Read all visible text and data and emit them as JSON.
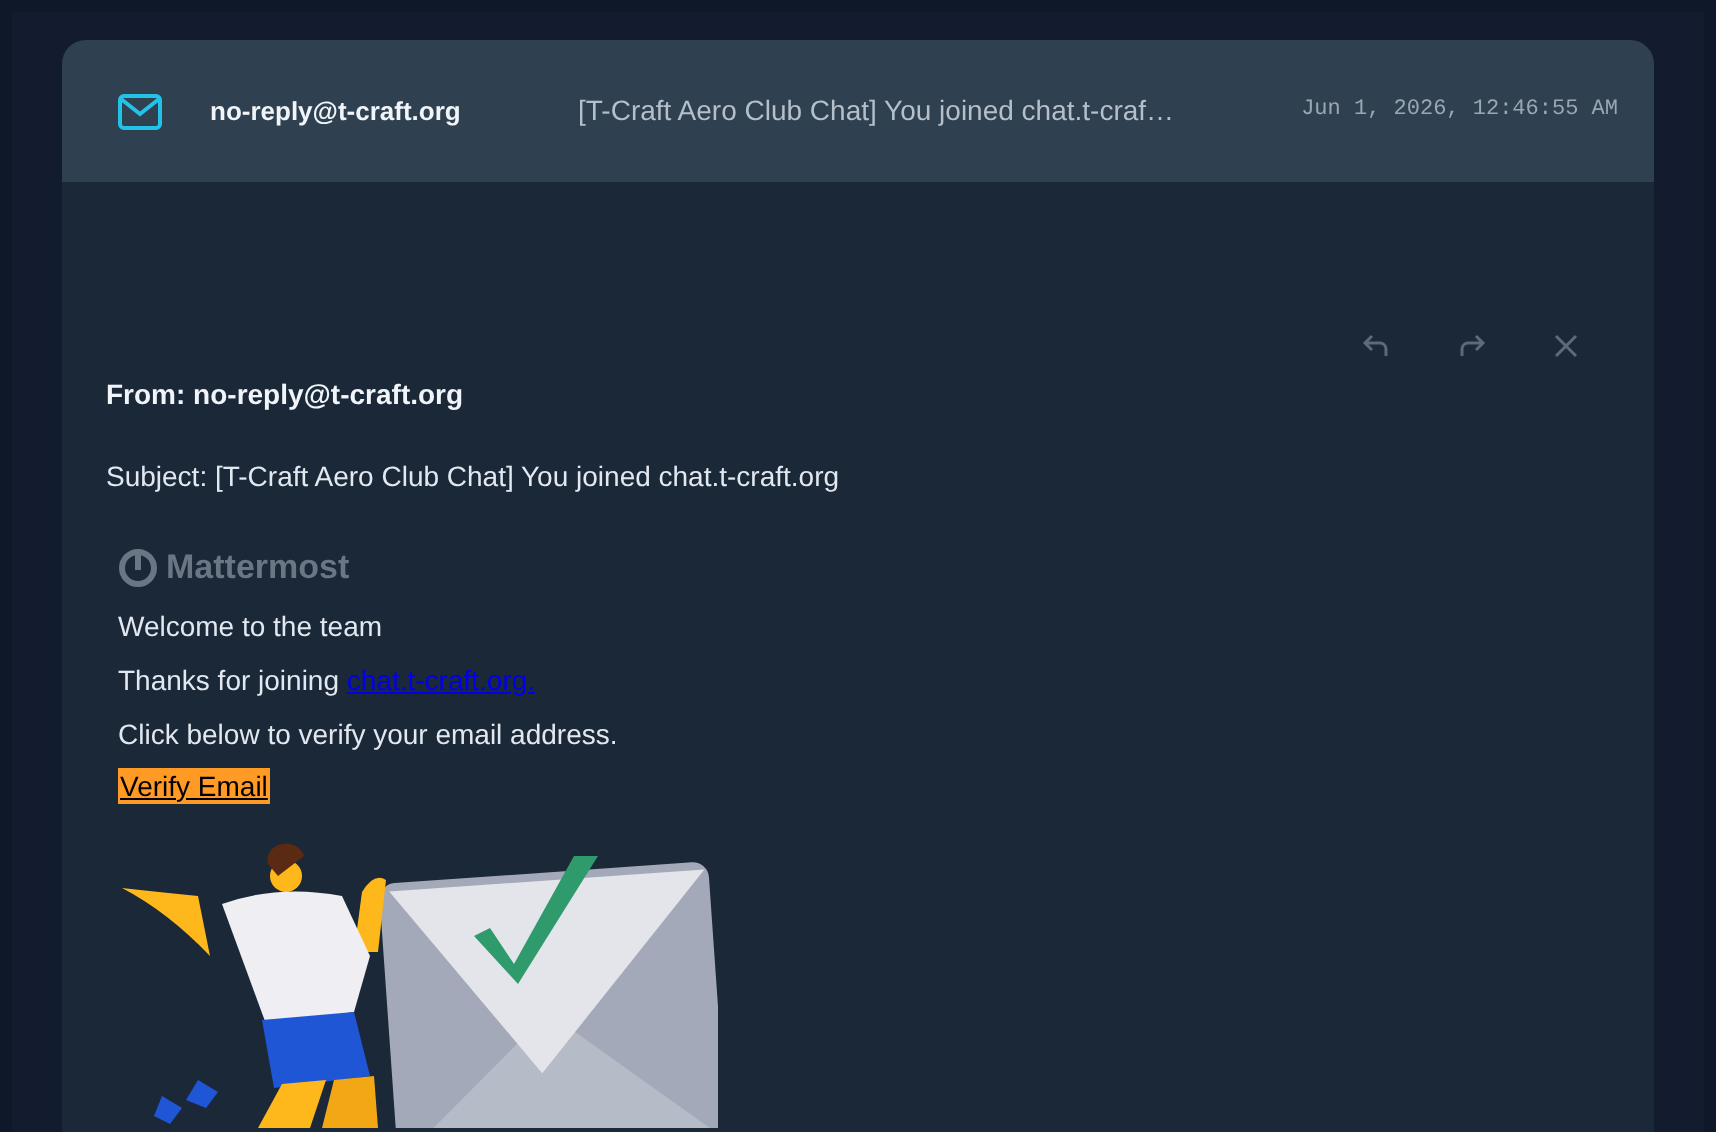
{
  "header": {
    "sender": "no-reply@t-craft.org",
    "subject": "[T-Craft Aero Club Chat] You joined chat.t-craf…",
    "date": "Jun 1, 2026, 12:46:55 AM"
  },
  "message": {
    "from": "From: no-reply@t-craft.org",
    "subject": "Subject: [T-Craft Aero Club Chat] You joined chat.t-craft.org"
  },
  "email_body": {
    "logo_text": "Mattermost",
    "welcome": "Welcome to the team",
    "thanks": "Thanks for joining ",
    "link": "chat.t-craft.org.",
    "instruction": "Click below to verify your email address.",
    "verify_button": "Verify Email"
  }
}
